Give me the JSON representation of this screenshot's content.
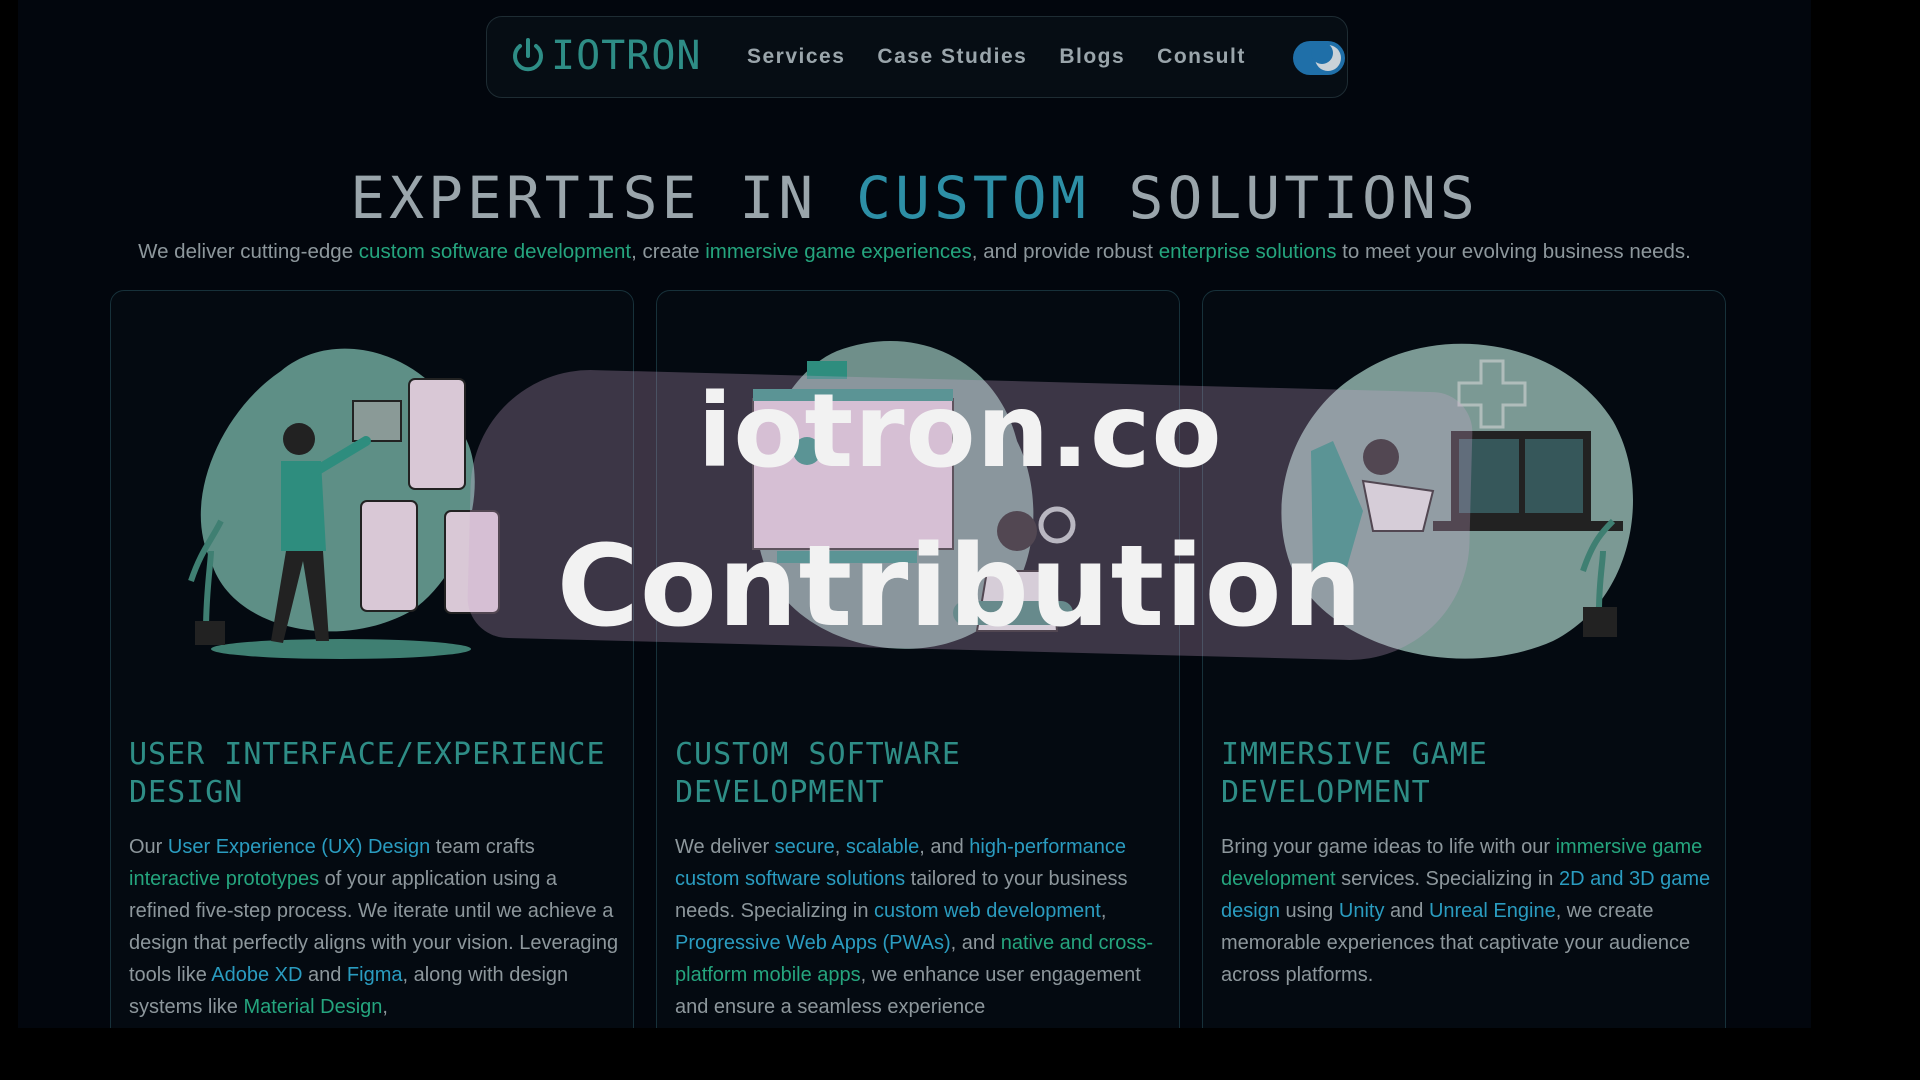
{
  "nav": {
    "logo_text": "IOTRON",
    "links": [
      "Services",
      "Case Studies",
      "Blogs",
      "Consult"
    ]
  },
  "hero": {
    "title_part1": "EXPERTISE IN",
    "title_accent": "CUSTOM",
    "title_part2": "SOLUTIONS",
    "subtitle": {
      "t1": "We deliver cutting-edge ",
      "h1": "custom software development",
      "t2": ", create ",
      "h2": "immersive game experiences",
      "t3": ", and provide robust ",
      "h3": "enterprise solutions",
      "t4": " to meet your evolving business needs."
    }
  },
  "cards": [
    {
      "title": "USER INTERFACE/EXPERIENCE DESIGN",
      "body": {
        "p1": "Our ",
        "h1": "User Experience (UX) Design",
        "p2": " team crafts ",
        "h2": "interactive prototypes",
        "p3": " of your application using a refined five-step process. We iterate until we achieve a design that perfectly aligns with your vision. Leveraging tools like ",
        "h3": "Adobe XD",
        "p4": " and ",
        "h4": "Figma",
        "p5": ", along with design systems like ",
        "h5": "Material Design",
        "p6": ","
      }
    },
    {
      "title": "CUSTOM SOFTWARE DEVELOPMENT",
      "body": {
        "p1": "We deliver ",
        "h1": "secure",
        "p2": ", ",
        "h2": "scalable",
        "p3": ", and ",
        "h3": "high-performance custom software solutions",
        "p4": " tailored to your business needs. Specializing in ",
        "h4": "custom web development",
        "p5": ", ",
        "h5": "Progressive Web Apps (PWAs)",
        "p6": ", and ",
        "h6": "native and cross-platform mobile apps",
        "p7": ", we enhance user engagement and ensure a seamless experience"
      }
    },
    {
      "title": "IMMERSIVE GAME DEVELOPMENT",
      "body": {
        "p1": "Bring your game ideas to life with our ",
        "h1": "immersive game development",
        "p2": " services. Specializing in ",
        "h2": "2D and 3D game design",
        "p3": " using ",
        "h3": "Unity",
        "p4": " and ",
        "h4": "Unreal Engine",
        "p5": ", we create memorable experiences that captivate your audience across platforms."
      }
    }
  ],
  "overlay": {
    "line1": "iotron.co",
    "line2": "Contribution"
  },
  "colors": {
    "accent_teal": "#2e8d86",
    "accent_green": "#25a57e",
    "accent_blue": "#2a9cc0",
    "toggle": "#1f6fa8"
  },
  "icons": [
    "power-icon",
    "moon-icon"
  ]
}
